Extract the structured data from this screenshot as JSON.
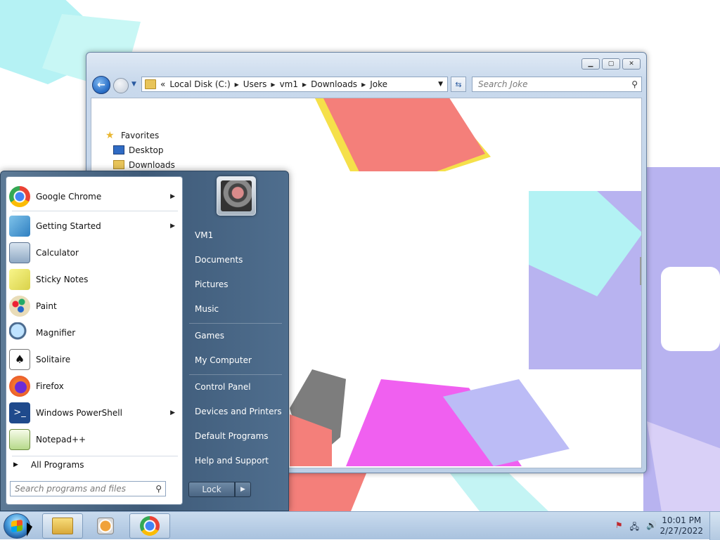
{
  "explorer": {
    "address": {
      "prefix": "«",
      "crumbs": [
        "Local Disk (C:)",
        "Users",
        "vm1",
        "Downloads",
        "Joke"
      ]
    },
    "search_placeholder": "Search Joke",
    "nav_pane": {
      "items": [
        "Favorites",
        "Desktop",
        "Downloads"
      ]
    }
  },
  "start_menu": {
    "programs": [
      {
        "label": "Google Chrome",
        "has_submenu": true
      },
      {
        "label": "Getting Started",
        "has_submenu": true
      },
      {
        "label": "Calculator",
        "has_submenu": false
      },
      {
        "label": "Sticky Notes",
        "has_submenu": false
      },
      {
        "label": "Paint",
        "has_submenu": false
      },
      {
        "label": "Magnifier",
        "has_submenu": false
      },
      {
        "label": "Solitaire",
        "has_submenu": false
      },
      {
        "label": "Firefox",
        "has_submenu": false
      },
      {
        "label": "Windows PowerShell",
        "has_submenu": true
      },
      {
        "label": "Notepad++",
        "has_submenu": false
      }
    ],
    "all_programs": "All Programs",
    "search_placeholder": "Search programs and files",
    "right_items": [
      "VM1",
      "Documents",
      "Pictures",
      "Music",
      "Games",
      "My Computer",
      "Control Panel",
      "Devices and Printers",
      "Default Programs",
      "Help and Support"
    ],
    "lock_label": "Lock"
  },
  "taskbar": {
    "clock_time": "10:01 PM",
    "clock_date": "2/27/2022"
  },
  "colors": {
    "taskbar": "#b9cde3",
    "start_menu": "#4f6e8e",
    "accent": "#2a6fc7"
  }
}
